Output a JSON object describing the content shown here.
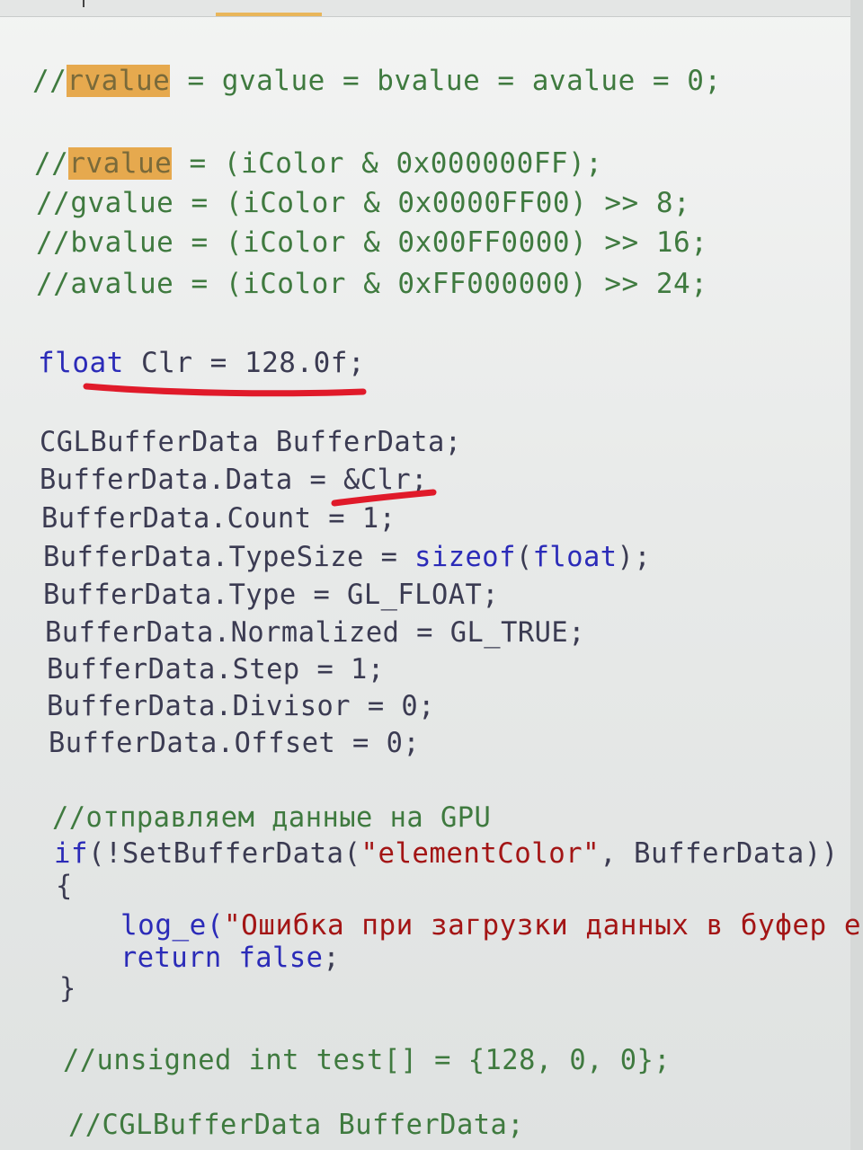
{
  "editor": {
    "lines": [
      {
        "id": "l1",
        "tokens": [
          {
            "t": "//",
            "c": "cm"
          },
          {
            "t": "rvalue",
            "c": "hl"
          },
          {
            "t": " = gvalue = bvalue = avalue = 0;",
            "c": "cm"
          }
        ]
      },
      {
        "id": "l2",
        "tokens": [
          {
            "t": "//",
            "c": "cm"
          },
          {
            "t": "rvalue",
            "c": "hl"
          },
          {
            "t": " = (iColor & 0x000000FF);",
            "c": "cm"
          }
        ]
      },
      {
        "id": "l3",
        "tokens": [
          {
            "t": "//gvalue = (iColor & 0x0000FF00) >> 8;",
            "c": "cm"
          }
        ]
      },
      {
        "id": "l4",
        "tokens": [
          {
            "t": "//bvalue = (iColor & 0x00FF0000) >> 16;",
            "c": "cm"
          }
        ]
      },
      {
        "id": "l5",
        "tokens": [
          {
            "t": "//avalue = (iColor & 0xFF000000) >> 24;",
            "c": "cm"
          }
        ]
      },
      {
        "id": "l6",
        "tokens": [
          {
            "t": "float",
            "c": "kw"
          },
          {
            "t": " Clr = 128.0f;",
            "c": "id"
          }
        ]
      },
      {
        "id": "l7",
        "tokens": [
          {
            "t": "CGLBufferData BufferData;",
            "c": "id"
          }
        ]
      },
      {
        "id": "l8",
        "tokens": [
          {
            "t": "BufferData.Data = &Clr;",
            "c": "id"
          }
        ]
      },
      {
        "id": "l9",
        "tokens": [
          {
            "t": "BufferData.Count = 1;",
            "c": "id"
          }
        ]
      },
      {
        "id": "l10",
        "tokens": [
          {
            "t": "BufferData.TypeSize = ",
            "c": "id"
          },
          {
            "t": "sizeof",
            "c": "kw"
          },
          {
            "t": "(",
            "c": "id"
          },
          {
            "t": "float",
            "c": "kw"
          },
          {
            "t": ");",
            "c": "id"
          }
        ]
      },
      {
        "id": "l11",
        "tokens": [
          {
            "t": "BufferData.Type = GL_FLOAT;",
            "c": "id"
          }
        ]
      },
      {
        "id": "l12",
        "tokens": [
          {
            "t": "BufferData.Normalized = GL_TRUE;",
            "c": "id"
          }
        ]
      },
      {
        "id": "l13",
        "tokens": [
          {
            "t": "BufferData.Step = 1;",
            "c": "id"
          }
        ]
      },
      {
        "id": "l14",
        "tokens": [
          {
            "t": "BufferData.Divisor = 0;",
            "c": "id"
          }
        ]
      },
      {
        "id": "l15",
        "tokens": [
          {
            "t": "BufferData.Offset = 0;",
            "c": "id"
          }
        ]
      },
      {
        "id": "l16",
        "tokens": [
          {
            "t": "//отправляем данные на GPU",
            "c": "cm"
          }
        ]
      },
      {
        "id": "l17",
        "tokens": [
          {
            "t": "if",
            "c": "kw"
          },
          {
            "t": "(!SetBufferData(",
            "c": "id"
          },
          {
            "t": "\"elementColor\"",
            "c": "str"
          },
          {
            "t": ", BufferData))",
            "c": "id"
          }
        ]
      },
      {
        "id": "l18",
        "tokens": [
          {
            "t": "{",
            "c": "id"
          }
        ]
      },
      {
        "id": "l19",
        "tokens": [
          {
            "t": "log_e(",
            "c": "kw"
          },
          {
            "t": "\"Ошибка при загрузки данных в буфер eleme",
            "c": "str"
          }
        ]
      },
      {
        "id": "l20",
        "tokens": [
          {
            "t": "return",
            "c": "kw"
          },
          {
            "t": " ",
            "c": "id"
          },
          {
            "t": "false",
            "c": "kw"
          },
          {
            "t": ";",
            "c": "id"
          }
        ]
      },
      {
        "id": "l21",
        "tokens": [
          {
            "t": "}",
            "c": "id"
          }
        ]
      },
      {
        "id": "l22",
        "tokens": [
          {
            "t": "//unsigned int test[] = {128, 0, 0};",
            "c": "cm"
          }
        ]
      },
      {
        "id": "l23",
        "tokens": [
          {
            "t": "//CGLBufferData BufferData;",
            "c": "cm"
          }
        ]
      }
    ]
  },
  "colors": {
    "comment": "#3f7a3f",
    "keyword": "#2b2bb8",
    "identifier": "#3b3b52",
    "string": "#a31515",
    "highlight": "#e6a94e",
    "annotation": "#e01a2a"
  }
}
